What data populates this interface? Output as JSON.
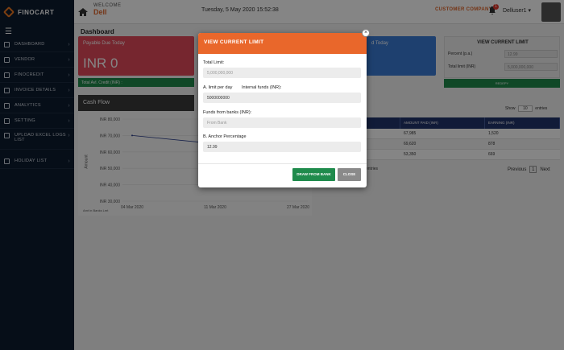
{
  "header": {
    "logo": "FINOCART",
    "welcome_small": "WELCOME",
    "welcome_name": "Dell",
    "datetime": "Tuesday, 5 May 2020 15:52:38",
    "company": "CUSTOMER COMPANY",
    "notification_count": "1",
    "user": "Delluser1"
  },
  "sidebar": {
    "items": [
      {
        "label": "DASHBOARD"
      },
      {
        "label": "VENDOR"
      },
      {
        "label": "FINOCREDIT"
      },
      {
        "label": "INVOICE DETAILS"
      },
      {
        "label": "ANALYTICS"
      },
      {
        "label": "SETTING"
      },
      {
        "label": "UPLOAD EXCEL LOGS"
      },
      {
        "label": "LIST"
      },
      {
        "label": "HOLIDAY LIST"
      }
    ]
  },
  "dashboard": {
    "title": "Dashboard",
    "card1_title": "Payable Due Today",
    "card1_value": "INR 0",
    "card2_title": "d Today",
    "credit_label": "Total Avl. Credit (INR) :",
    "cashflow_title": "Cash Flow",
    "chart_axis_label": "Amount",
    "chart_footnote": "Amt in Banks  Lmt",
    "current_limit_title": "VIEW CURRENT LIMIT",
    "percent_label": "Percent (p.a.)",
    "percent_value": "12.99",
    "total_limit_label": "Total limit (INR)",
    "total_limit_value": "5,000,000,000",
    "green_btn": "REDEPY",
    "show_label": "Show",
    "show_value": "10",
    "entries_label": "entries",
    "col_amount_paid": "AMOUNT PAID (INR)",
    "col_earning": "EARNING (INR)",
    "rows": [
      {
        "amount": "67,985",
        "earning": "1,520"
      },
      {
        "amount": "69,620",
        "earning": "878"
      },
      {
        "amount": "53,350",
        "earning": "669"
      }
    ],
    "entries_footer": "entries",
    "prev": "Previous",
    "page": "1",
    "next": "Next"
  },
  "chart_data": {
    "type": "line",
    "x": [
      "04 Mar 2020",
      "11 Mar 2020",
      "27 Mar 2020"
    ],
    "yticks": [
      "INR 80,000",
      "INR 70,000",
      "INR 60,000",
      "INR 50,000",
      "INR 40,000",
      "INR 30,000"
    ],
    "series": [
      {
        "values": [
          70000,
          65000,
          null
        ]
      }
    ],
    "ylabel": "Amount",
    "ylim": [
      30000,
      80000
    ]
  },
  "modal": {
    "title": "VIEW CURRENT LIMIT",
    "close_symbol": "×",
    "total_limit_label": "Total Limit:",
    "total_limit_value": "5,000,000,000",
    "limit_per_day_label": "A. limit per day",
    "internal_funds_label": "Internal funds (INR):",
    "internal_funds_value": "5000000000",
    "funds_from_banks_label": "Funds from banks (INR):",
    "funds_from_banks_placeholder": "From Bank",
    "anchor_pct_label": "B. Anchor Percentage",
    "anchor_pct_value": "12.99",
    "draw_btn": "DRAW FROM BANK",
    "close_btn": "CLOSE"
  },
  "colors": {
    "accent": "#e9672b",
    "sidebar": "#0d1b2e",
    "green": "#1f8b4c",
    "table_head": "#22346b"
  }
}
